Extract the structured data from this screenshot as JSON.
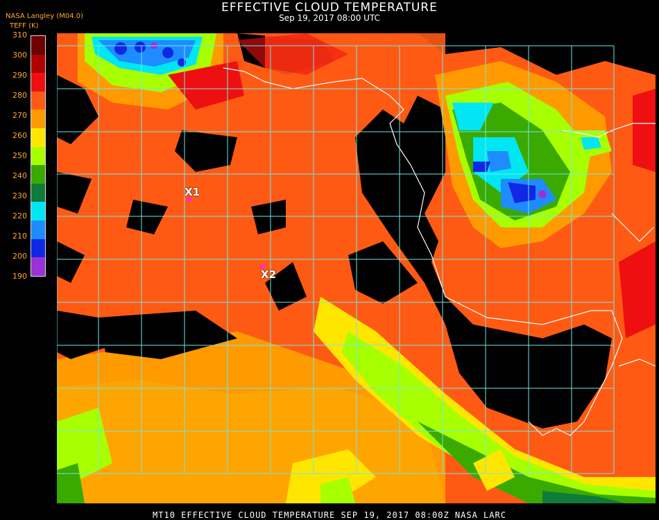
{
  "header": {
    "title": "EFFECTIVE CLOUD TEMPERATURE",
    "subtitle": "Sep 19, 2017 08:00 UTC",
    "org": "NASA Langley (M04.0)",
    "units": "TEFF (K)"
  },
  "legend": {
    "ticks": [
      "310",
      "300",
      "290",
      "280",
      "270",
      "260",
      "250",
      "240",
      "230",
      "220",
      "210",
      "200",
      "190"
    ],
    "colors": [
      "#6e0000",
      "#b00000",
      "#ee1010",
      "#ff5a14",
      "#ff9a00",
      "#ffe600",
      "#a8ff00",
      "#3aaa00",
      "#0f7a3a",
      "#00e6f2",
      "#1e8cff",
      "#1028e6",
      "#9a33d6"
    ]
  },
  "markers": [
    {
      "id": "X1",
      "label": "X1"
    },
    {
      "id": "X2",
      "label": "X2"
    }
  ],
  "footer": "MT10  EFFECTIVE CLOUD TEMPERATURE   SEP 19, 2017 08:00Z   NASA LARC",
  "map_palette": {
    "ocean_warm": "#ff5a14",
    "subtropical": "#ff9a00",
    "clear": "#000000",
    "grid": "#6fe8e8",
    "coast": "#ffffff"
  }
}
